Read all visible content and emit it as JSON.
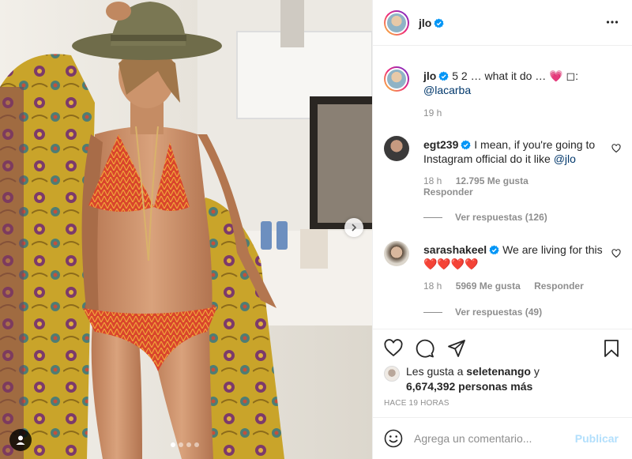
{
  "post": {
    "author": "jlo",
    "caption_text": "5 2 … what it do … 💗 ◻:",
    "caption_mention": "@lacarba",
    "caption_age": "19 h",
    "more_icon": "more-horizontal-icon"
  },
  "comments": [
    {
      "user": "egt239",
      "text": "I mean, if you're going to Instagram official do it like",
      "mention": "@jlo",
      "age": "18 h",
      "likes": "12.795 Me gusta",
      "reply_label": "Responder",
      "view_replies": "Ver respuestas (126)"
    },
    {
      "user": "sarashakeel",
      "text": "We are living for this ❤️❤️❤️❤️",
      "age": "18 h",
      "likes": "5969 Me gusta",
      "reply_label": "Responder",
      "view_replies": "Ver respuestas (49)"
    }
  ],
  "likes": {
    "prefix": "Les gusta a",
    "user": "seletenango",
    "connector": "y",
    "count_text": "6,674,392 personas más"
  },
  "timestamp": "HACE 19 HORAS",
  "composer": {
    "placeholder": "Agrega un comentario...",
    "publish_label": "Publicar"
  },
  "carousel": {
    "slides": 4,
    "active_index": 0
  },
  "colors": {
    "verified": "#0095f6",
    "link": "#00376b",
    "muted": "#8e8e8e",
    "publish": "#b2dffc"
  }
}
